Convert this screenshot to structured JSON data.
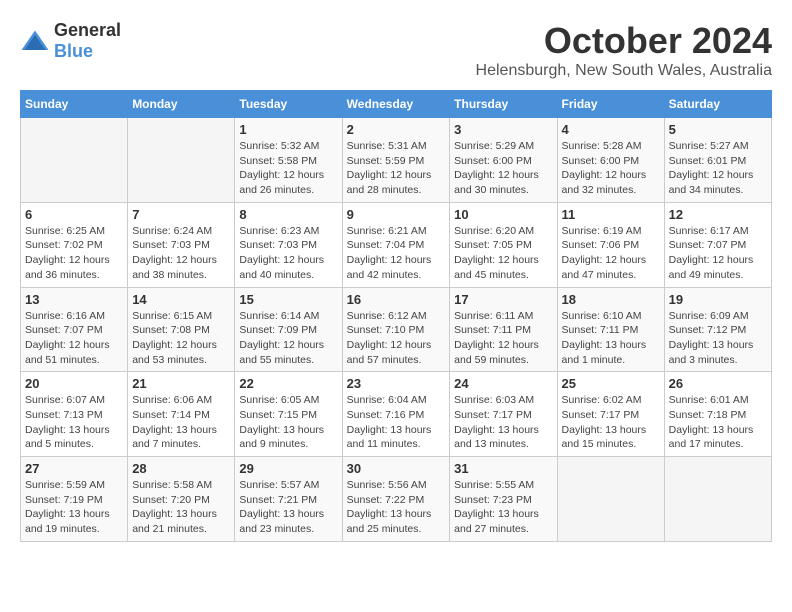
{
  "logo": {
    "general": "General",
    "blue": "Blue"
  },
  "title": "October 2024",
  "location": "Helensburgh, New South Wales, Australia",
  "weekdays": [
    "Sunday",
    "Monday",
    "Tuesday",
    "Wednesday",
    "Thursday",
    "Friday",
    "Saturday"
  ],
  "weeks": [
    [
      {
        "day": "",
        "info": ""
      },
      {
        "day": "",
        "info": ""
      },
      {
        "day": "1",
        "info": "Sunrise: 5:32 AM\nSunset: 5:58 PM\nDaylight: 12 hours\nand 26 minutes."
      },
      {
        "day": "2",
        "info": "Sunrise: 5:31 AM\nSunset: 5:59 PM\nDaylight: 12 hours\nand 28 minutes."
      },
      {
        "day": "3",
        "info": "Sunrise: 5:29 AM\nSunset: 6:00 PM\nDaylight: 12 hours\nand 30 minutes."
      },
      {
        "day": "4",
        "info": "Sunrise: 5:28 AM\nSunset: 6:00 PM\nDaylight: 12 hours\nand 32 minutes."
      },
      {
        "day": "5",
        "info": "Sunrise: 5:27 AM\nSunset: 6:01 PM\nDaylight: 12 hours\nand 34 minutes."
      }
    ],
    [
      {
        "day": "6",
        "info": "Sunrise: 6:25 AM\nSunset: 7:02 PM\nDaylight: 12 hours\nand 36 minutes."
      },
      {
        "day": "7",
        "info": "Sunrise: 6:24 AM\nSunset: 7:03 PM\nDaylight: 12 hours\nand 38 minutes."
      },
      {
        "day": "8",
        "info": "Sunrise: 6:23 AM\nSunset: 7:03 PM\nDaylight: 12 hours\nand 40 minutes."
      },
      {
        "day": "9",
        "info": "Sunrise: 6:21 AM\nSunset: 7:04 PM\nDaylight: 12 hours\nand 42 minutes."
      },
      {
        "day": "10",
        "info": "Sunrise: 6:20 AM\nSunset: 7:05 PM\nDaylight: 12 hours\nand 45 minutes."
      },
      {
        "day": "11",
        "info": "Sunrise: 6:19 AM\nSunset: 7:06 PM\nDaylight: 12 hours\nand 47 minutes."
      },
      {
        "day": "12",
        "info": "Sunrise: 6:17 AM\nSunset: 7:07 PM\nDaylight: 12 hours\nand 49 minutes."
      }
    ],
    [
      {
        "day": "13",
        "info": "Sunrise: 6:16 AM\nSunset: 7:07 PM\nDaylight: 12 hours\nand 51 minutes."
      },
      {
        "day": "14",
        "info": "Sunrise: 6:15 AM\nSunset: 7:08 PM\nDaylight: 12 hours\nand 53 minutes."
      },
      {
        "day": "15",
        "info": "Sunrise: 6:14 AM\nSunset: 7:09 PM\nDaylight: 12 hours\nand 55 minutes."
      },
      {
        "day": "16",
        "info": "Sunrise: 6:12 AM\nSunset: 7:10 PM\nDaylight: 12 hours\nand 57 minutes."
      },
      {
        "day": "17",
        "info": "Sunrise: 6:11 AM\nSunset: 7:11 PM\nDaylight: 12 hours\nand 59 minutes."
      },
      {
        "day": "18",
        "info": "Sunrise: 6:10 AM\nSunset: 7:11 PM\nDaylight: 13 hours\nand 1 minute."
      },
      {
        "day": "19",
        "info": "Sunrise: 6:09 AM\nSunset: 7:12 PM\nDaylight: 13 hours\nand 3 minutes."
      }
    ],
    [
      {
        "day": "20",
        "info": "Sunrise: 6:07 AM\nSunset: 7:13 PM\nDaylight: 13 hours\nand 5 minutes."
      },
      {
        "day": "21",
        "info": "Sunrise: 6:06 AM\nSunset: 7:14 PM\nDaylight: 13 hours\nand 7 minutes."
      },
      {
        "day": "22",
        "info": "Sunrise: 6:05 AM\nSunset: 7:15 PM\nDaylight: 13 hours\nand 9 minutes."
      },
      {
        "day": "23",
        "info": "Sunrise: 6:04 AM\nSunset: 7:16 PM\nDaylight: 13 hours\nand 11 minutes."
      },
      {
        "day": "24",
        "info": "Sunrise: 6:03 AM\nSunset: 7:17 PM\nDaylight: 13 hours\nand 13 minutes."
      },
      {
        "day": "25",
        "info": "Sunrise: 6:02 AM\nSunset: 7:17 PM\nDaylight: 13 hours\nand 15 minutes."
      },
      {
        "day": "26",
        "info": "Sunrise: 6:01 AM\nSunset: 7:18 PM\nDaylight: 13 hours\nand 17 minutes."
      }
    ],
    [
      {
        "day": "27",
        "info": "Sunrise: 5:59 AM\nSunset: 7:19 PM\nDaylight: 13 hours\nand 19 minutes."
      },
      {
        "day": "28",
        "info": "Sunrise: 5:58 AM\nSunset: 7:20 PM\nDaylight: 13 hours\nand 21 minutes."
      },
      {
        "day": "29",
        "info": "Sunrise: 5:57 AM\nSunset: 7:21 PM\nDaylight: 13 hours\nand 23 minutes."
      },
      {
        "day": "30",
        "info": "Sunrise: 5:56 AM\nSunset: 7:22 PM\nDaylight: 13 hours\nand 25 minutes."
      },
      {
        "day": "31",
        "info": "Sunrise: 5:55 AM\nSunset: 7:23 PM\nDaylight: 13 hours\nand 27 minutes."
      },
      {
        "day": "",
        "info": ""
      },
      {
        "day": "",
        "info": ""
      }
    ]
  ]
}
